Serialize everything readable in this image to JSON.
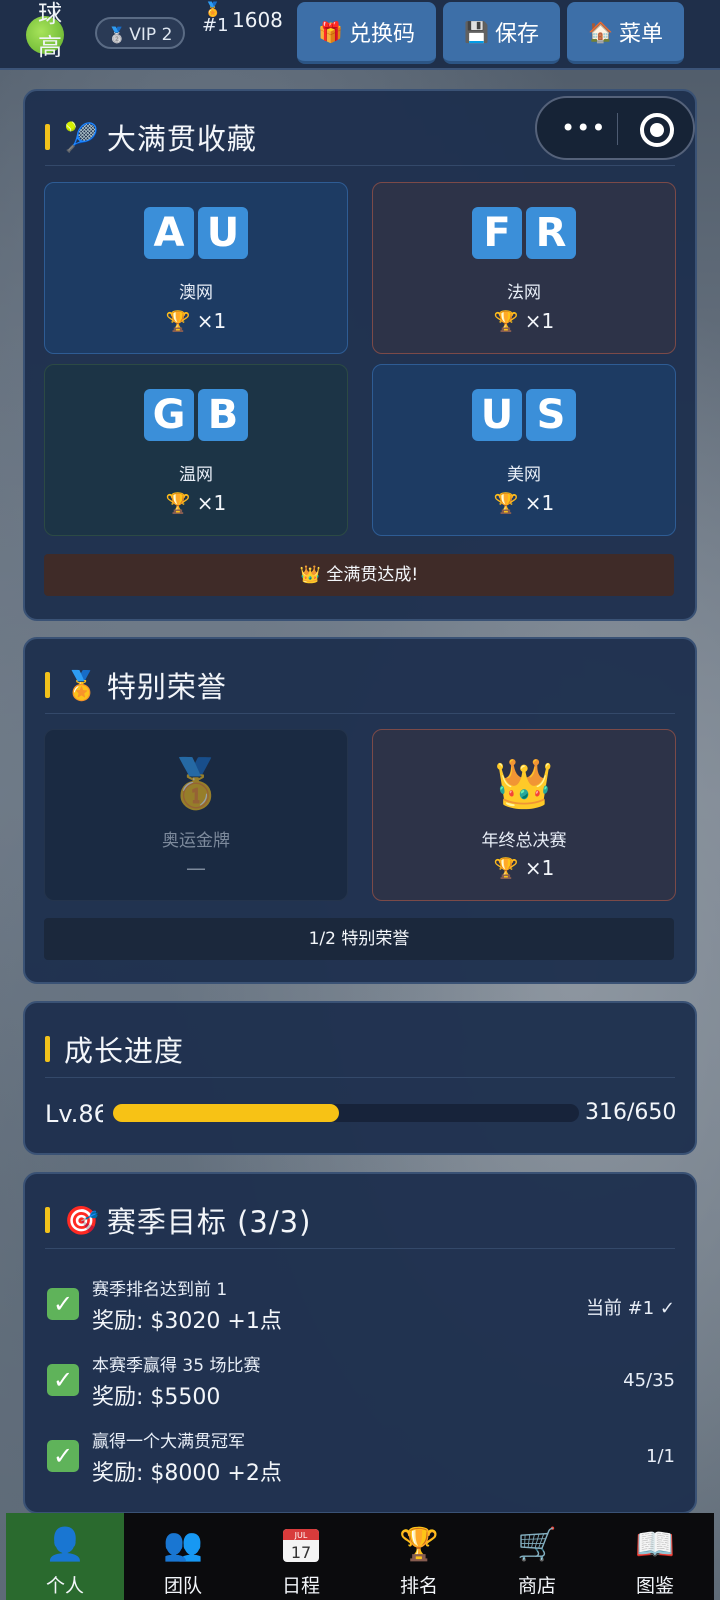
{
  "topbar": {
    "player_name": "球高",
    "vip_label": "VIP 2",
    "rank_label": "#1",
    "money": "1608",
    "buttons": [
      {
        "icon": "gift-icon",
        "label": "兑换码"
      },
      {
        "icon": "floppy-disk-icon",
        "label": "保存"
      },
      {
        "icon": "house-icon",
        "label": "菜单"
      }
    ]
  },
  "grand_slam": {
    "title": "大满贯收藏",
    "title_icon": "tennis-ball-icon",
    "tournaments": [
      {
        "code": [
          "A",
          "U"
        ],
        "name": "澳网",
        "count": "×1"
      },
      {
        "code": [
          "F",
          "R"
        ],
        "name": "法网",
        "count": "×1"
      },
      {
        "code": [
          "G",
          "B"
        ],
        "name": "温网",
        "count": "×1"
      },
      {
        "code": [
          "U",
          "S"
        ],
        "name": "美网",
        "count": "×1"
      }
    ],
    "banner": "全满贯达成!",
    "banner_icon": "crown-icon"
  },
  "special_honors": {
    "title": "特别荣誉",
    "title_icon": "medal-icon",
    "items": [
      {
        "name": "奥运金牌",
        "count": "—",
        "icon": "gold-medal-icon",
        "achieved": false
      },
      {
        "name": "年终总决赛",
        "count": "×1",
        "icon": "crown-icon",
        "achieved": true
      }
    ],
    "summary": "1/2 特别荣誉"
  },
  "growth": {
    "title": "成长进度",
    "level": "Lv.86",
    "xp": "316/650",
    "progress_fraction": 0.486
  },
  "season_goals": {
    "title": "赛季目标 (3/3)",
    "title_icon": "target-icon",
    "goals": [
      {
        "desc": "赛季排名达到前 1",
        "reward": "奖励: $3020 +1点",
        "status": "当前 #1 ✓"
      },
      {
        "desc": "本赛季赢得 35 场比赛",
        "reward": "奖励: $5500",
        "status": "45/35"
      },
      {
        "desc": "赢得一个大满贯冠军",
        "reward": "奖励: $8000 +2点",
        "status": "1/1"
      }
    ]
  },
  "bottom_nav": [
    {
      "label": "个人",
      "icon": "person-icon",
      "active": true
    },
    {
      "label": "团队",
      "icon": "people-icon",
      "active": false
    },
    {
      "label": "日程",
      "icon": "calendar-icon",
      "active": false,
      "calendar_month": "JUL",
      "calendar_day": "17"
    },
    {
      "label": "排名",
      "icon": "trophy-icon",
      "active": false
    },
    {
      "label": "商店",
      "icon": "shopping-cart-icon",
      "active": false
    },
    {
      "label": "图鉴",
      "icon": "open-book-icon",
      "active": false
    }
  ],
  "colors": {
    "accent": "#f2c21b",
    "card_bg": "#1e304e",
    "slam_blue": "#3b8fd9",
    "progress": "#f7c215",
    "check_green": "#5fb35a",
    "nav_active": "#2a6a2e"
  }
}
